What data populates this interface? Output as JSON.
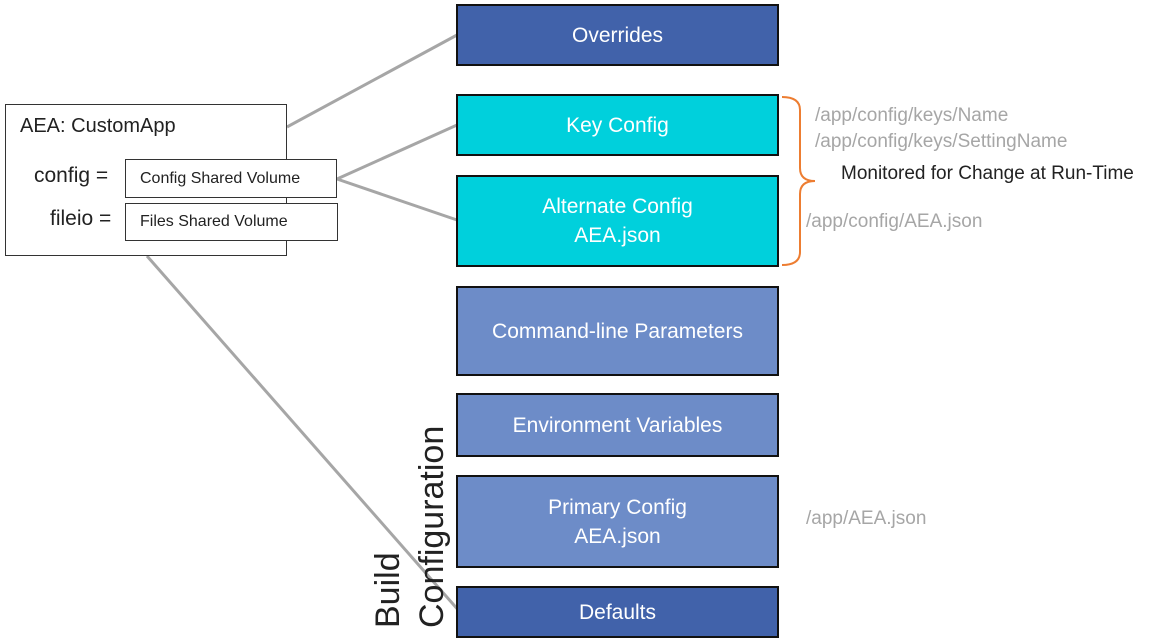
{
  "colors": {
    "overrides": "#4162aa",
    "runtime": "#00d0dc",
    "build": "#6d8cc8",
    "connector": "#a6a6a6",
    "brace": "#ed7d31"
  },
  "layers": [
    {
      "lines": [
        "Overrides"
      ]
    },
    {
      "lines": [
        "Key Config"
      ]
    },
    {
      "lines": [
        "Alternate Config",
        "AEA.json"
      ]
    },
    {
      "lines": [
        "Command-line Parameters"
      ]
    },
    {
      "lines": [
        "Environment Variables"
      ]
    },
    {
      "lines": [
        "Primary Config",
        "AEA.json"
      ]
    },
    {
      "lines": [
        "Defaults"
      ]
    }
  ],
  "app": {
    "title": "AEA: CustomApp",
    "config_label": "config =",
    "config_value": "Config Shared Volume",
    "fileio_label": "fileio =",
    "fileio_value": "Files Shared Volume"
  },
  "paths": {
    "key_config": [
      "/app/config/keys/Name",
      "/app/config/keys/SettingName"
    ],
    "alt_config": "/app/config/AEA.json",
    "primary_config": "/app/AEA.json"
  },
  "runtime_note": "Monitored for Change at Run-Time",
  "build_label": [
    "Build",
    "Configuration"
  ]
}
